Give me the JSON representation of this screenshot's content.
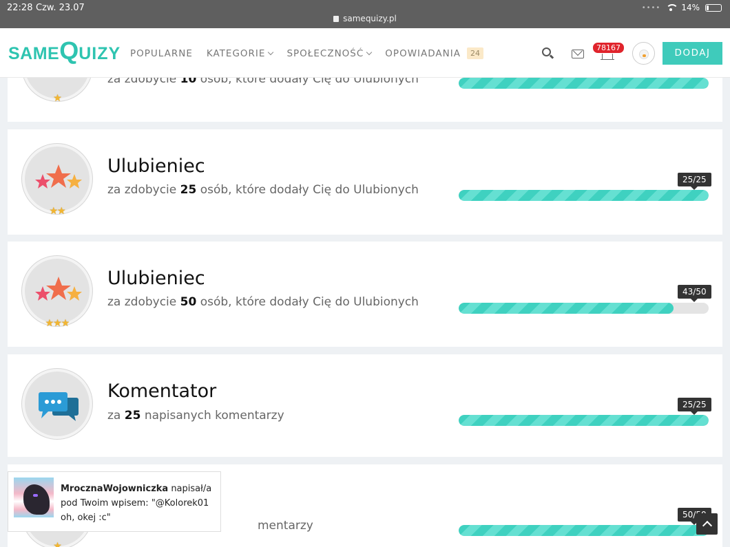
{
  "status_bar": {
    "time": "22:28",
    "date": "Czw. 23.07",
    "url": "samequizy.pl",
    "battery": "14%"
  },
  "header": {
    "logo": {
      "same": "SAME",
      "q": "Q",
      "uizy": "UIZY"
    },
    "nav": [
      {
        "label": "POPULARNE"
      },
      {
        "label": "KATEGORIE"
      },
      {
        "label": "SPOŁECZNOŚĆ"
      },
      {
        "label": "OPOWIADANIA",
        "badge": "24"
      }
    ],
    "notifications": "78167",
    "add_button": "DODAJ"
  },
  "achievements": [
    {
      "title": "",
      "prefix": "za zdobycie",
      "number": "10",
      "suffix": "osób, które dodały Cię do Ulubionych",
      "progress": 1.0,
      "pips": "★"
    },
    {
      "title": "Ulubieniec",
      "prefix": "za zdobycie",
      "number": "25",
      "suffix": "osób, które dodały Cię do Ulubionych",
      "tooltip": "25/25",
      "progress": 1.0,
      "pips": "★★"
    },
    {
      "title": "Ulubieniec",
      "prefix": "za zdobycie",
      "number": "50",
      "suffix": "osób, które dodały Cię do Ulubionych",
      "tooltip": "43/50",
      "progress": 0.86,
      "pips": "★★★"
    },
    {
      "title": "Komentator",
      "prefix": "za",
      "number": "25",
      "suffix": "napisanych komentarzy",
      "tooltip": "25/25",
      "progress": 1.0
    },
    {
      "title": "",
      "suffix": "mentarzy",
      "tooltip": "50/50",
      "progress": 1.0,
      "pips": "★"
    }
  ],
  "toast": {
    "user": "MrocznaWojowniczka",
    "message": " napisał/a pod Twoim wpisem: \"@Kolorek01 oh, okej :c\""
  },
  "colors": {
    "brand": "#2ec4b0",
    "button": "#3fcbbb",
    "progress": "#3fd1c0",
    "notif_badge": "#e0242c"
  }
}
